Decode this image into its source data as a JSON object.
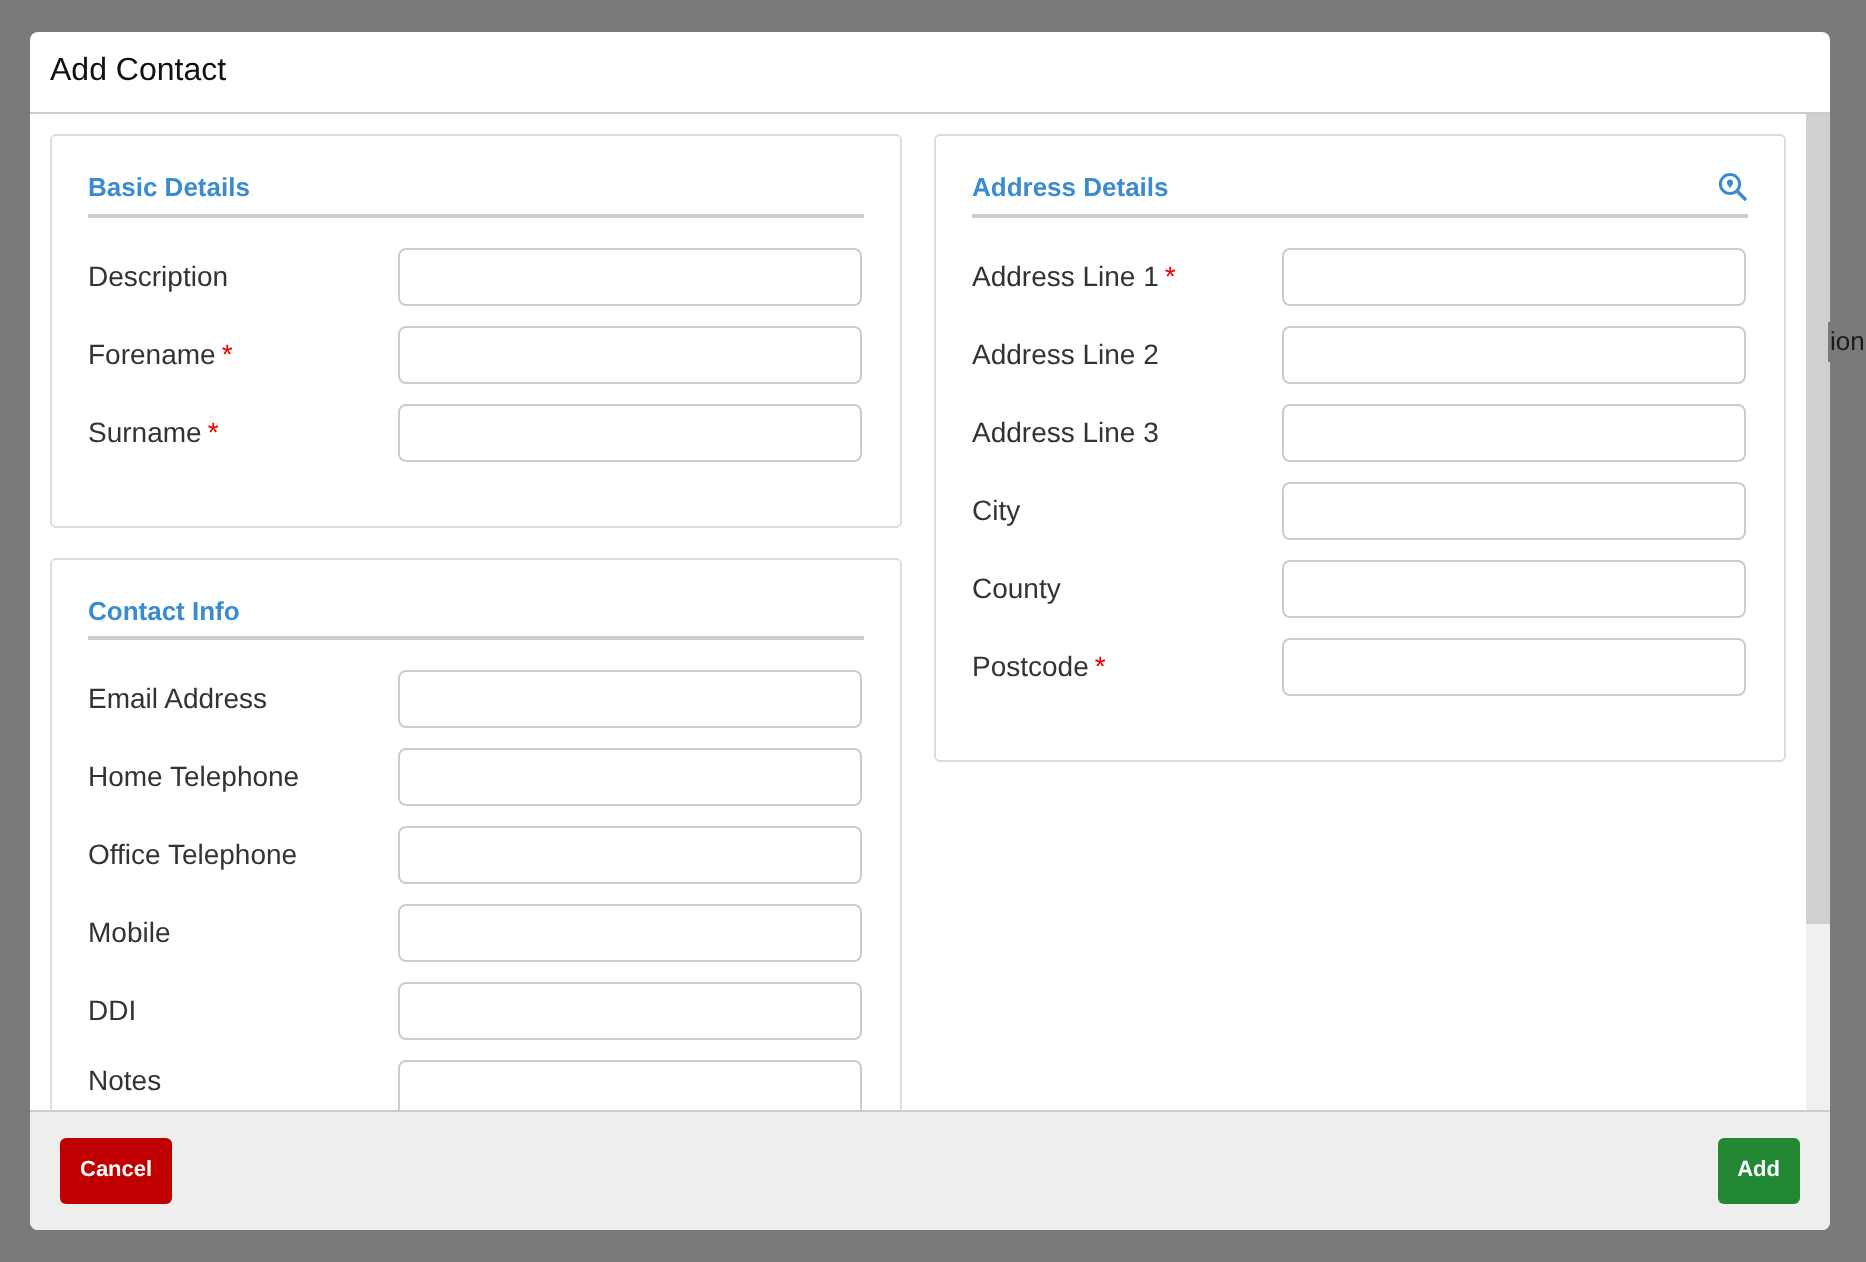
{
  "background": {
    "fragment_text": "ion"
  },
  "modal": {
    "title": "Add Contact",
    "columns": [
      [
        {
          "title": "Basic Details",
          "action_icon": false,
          "fields": [
            {
              "label": "Description",
              "required": false,
              "kind": "input"
            },
            {
              "label": "Forename",
              "required": true,
              "kind": "input"
            },
            {
              "label": "Surname",
              "required": true,
              "kind": "input"
            }
          ]
        },
        {
          "title": "Contact Info",
          "action_icon": false,
          "fields": [
            {
              "label": "Email Address",
              "required": false,
              "kind": "input"
            },
            {
              "label": "Home Telephone",
              "required": false,
              "kind": "input"
            },
            {
              "label": "Office Telephone",
              "required": false,
              "kind": "input"
            },
            {
              "label": "Mobile",
              "required": false,
              "kind": "input"
            },
            {
              "label": "DDI",
              "required": false,
              "kind": "input"
            },
            {
              "label": "Notes",
              "required": false,
              "kind": "textarea"
            }
          ]
        }
      ],
      [
        {
          "title": "Address Details",
          "action_icon": true,
          "fields": [
            {
              "label": "Address Line 1",
              "required": true,
              "kind": "input"
            },
            {
              "label": "Address Line 2",
              "required": false,
              "kind": "input"
            },
            {
              "label": "Address Line 3",
              "required": false,
              "kind": "input"
            },
            {
              "label": "City",
              "required": false,
              "kind": "input"
            },
            {
              "label": "County",
              "required": false,
              "kind": "input"
            },
            {
              "label": "Postcode",
              "required": true,
              "kind": "input"
            }
          ]
        }
      ]
    ],
    "required_mark": "*",
    "buttons": [
      {
        "label": "Cancel",
        "kind": "danger"
      },
      {
        "label": "Add",
        "kind": "success"
      }
    ]
  }
}
